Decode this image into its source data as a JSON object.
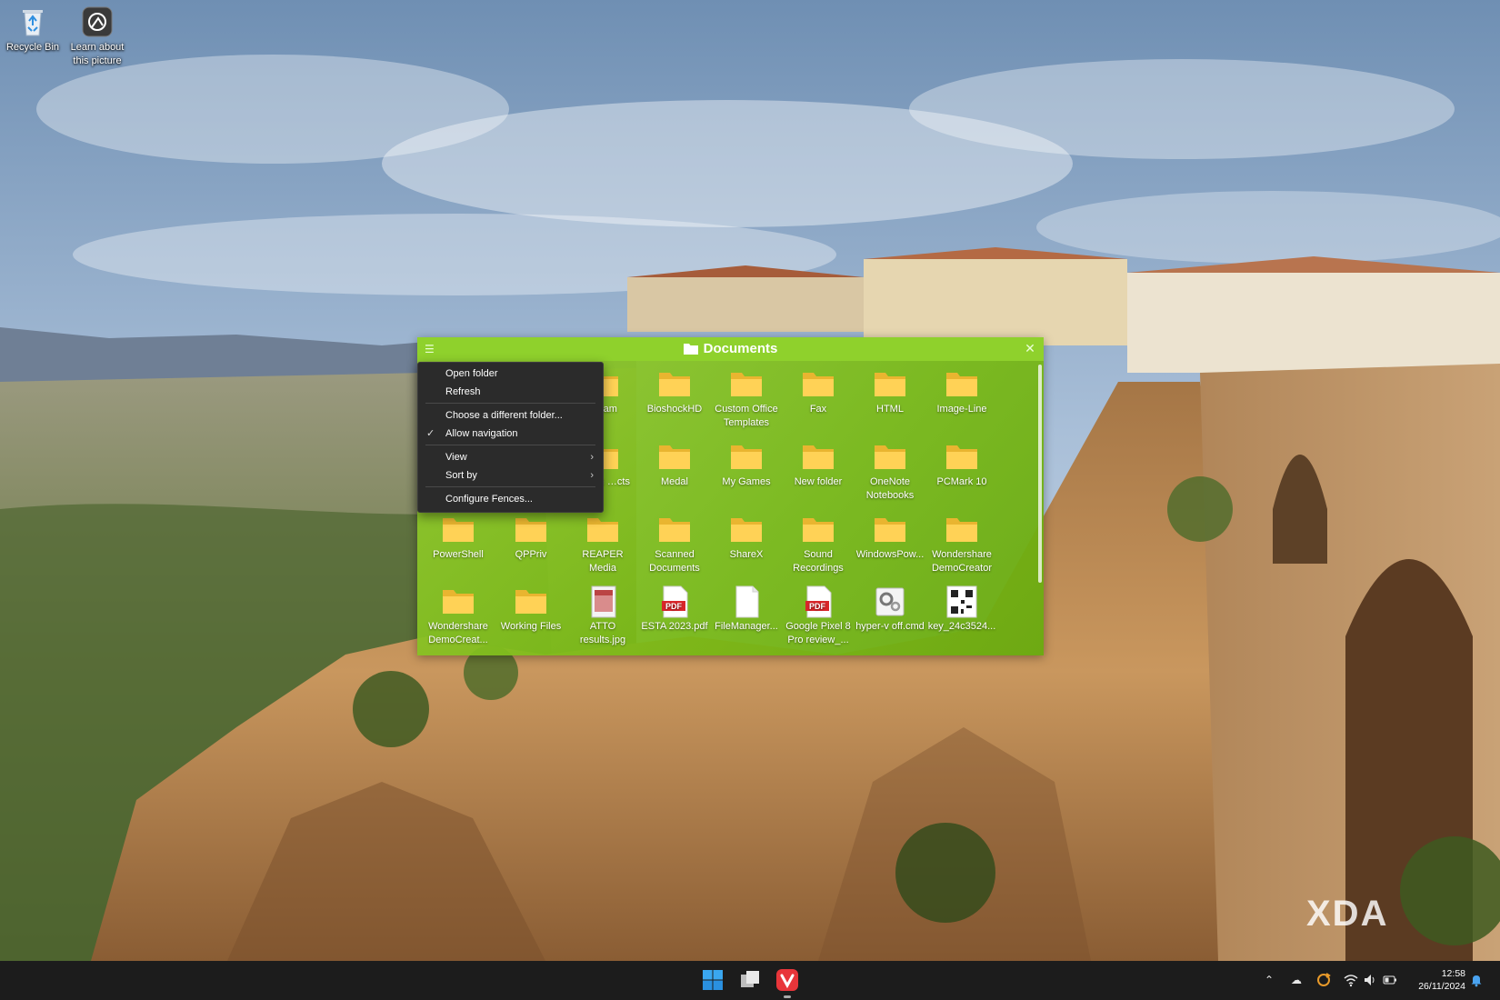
{
  "desktop": {
    "icons": [
      {
        "label": "Recycle Bin",
        "icon": "recycle-bin-icon"
      },
      {
        "label": "Learn about this picture",
        "icon": "camera-icon"
      }
    ]
  },
  "fence": {
    "title": "Documents",
    "accent": "#8fd12c",
    "items": [
      {
        "label": "…cam",
        "icon": "folder-icon"
      },
      {
        "label": "BioshockHD",
        "icon": "folder-icon"
      },
      {
        "label": "Custom Office Templates",
        "icon": "folder-icon"
      },
      {
        "label": "Fax",
        "icon": "folder-icon"
      },
      {
        "label": "HTML",
        "icon": "folder-icon"
      },
      {
        "label": "Image-Line",
        "icon": "folder-icon"
      },
      {
        "label": "…cam …cts",
        "icon": "folder-icon"
      },
      {
        "label": "Medal",
        "icon": "folder-icon"
      },
      {
        "label": "My Games",
        "icon": "folder-icon"
      },
      {
        "label": "New folder",
        "icon": "folder-icon"
      },
      {
        "label": "OneNote Notebooks",
        "icon": "folder-icon"
      },
      {
        "label": "PCMark 10",
        "icon": "folder-icon"
      },
      {
        "label": "PowerShell",
        "icon": "folder-icon"
      },
      {
        "label": "QPPriv",
        "icon": "folder-icon"
      },
      {
        "label": "REAPER Media",
        "icon": "folder-icon"
      },
      {
        "label": "Scanned Documents",
        "icon": "folder-icon"
      },
      {
        "label": "ShareX",
        "icon": "folder-icon"
      },
      {
        "label": "Sound Recordings",
        "icon": "folder-icon"
      },
      {
        "label": "WindowsPow...",
        "icon": "folder-icon"
      },
      {
        "label": "Wondershare DemoCreator",
        "icon": "folder-icon"
      },
      {
        "label": "Wondershare DemoCreat...",
        "icon": "folder-icon"
      },
      {
        "label": "Working Files",
        "icon": "folder-icon"
      },
      {
        "label": "ATTO results.jpg",
        "icon": "image-file-icon"
      },
      {
        "label": "ESTA 2023.pdf",
        "icon": "pdf-file-icon"
      },
      {
        "label": "FileManager...",
        "icon": "blank-file-icon"
      },
      {
        "label": "Google Pixel 8 Pro review_...",
        "icon": "pdf-file-icon"
      },
      {
        "label": "hyper-v off.cmd",
        "icon": "cmd-file-icon"
      },
      {
        "label": "key_24c3524...",
        "icon": "qr-image-icon"
      }
    ]
  },
  "context_menu": {
    "items": [
      {
        "label": "Open folder",
        "checked": false,
        "submenu": false
      },
      {
        "label": "Refresh",
        "checked": false,
        "submenu": false
      },
      {
        "label": "Choose a different folder...",
        "checked": false,
        "submenu": false
      },
      {
        "label": "Allow navigation",
        "checked": true,
        "submenu": false
      },
      {
        "label": "View",
        "checked": false,
        "submenu": true
      },
      {
        "label": "Sort by",
        "checked": false,
        "submenu": true
      },
      {
        "label": "Configure Fences...",
        "checked": false,
        "submenu": false
      }
    ],
    "check_glyph": "✓",
    "submenu_glyph": "›"
  },
  "taskbar": {
    "time": "12:58",
    "date": "26/11/2024",
    "pinned": [
      "windows-start-icon",
      "task-view-icon",
      "vivaldi-browser-icon"
    ],
    "tray": [
      "chevron-up-icon",
      "onedrive-cloud-icon",
      "sync-icon",
      "wifi-icon",
      "volume-icon",
      "battery-icon",
      "notification-bell-icon"
    ]
  },
  "watermark": "XDA"
}
